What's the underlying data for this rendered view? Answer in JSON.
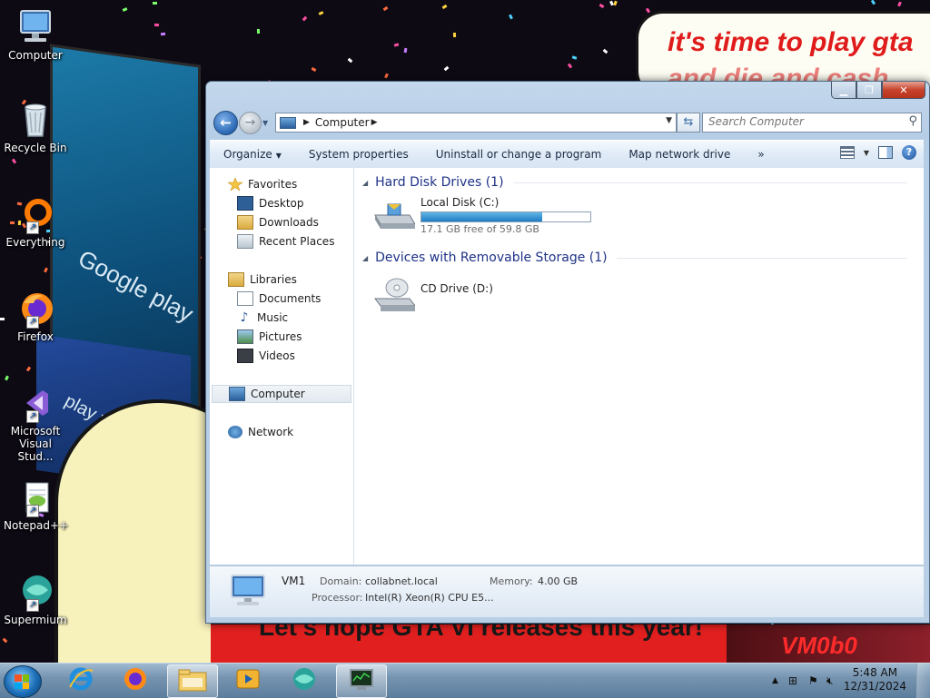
{
  "desktop": {
    "wallpaper_text_top": "it's time to play gta",
    "wallpaper_text_top2": "and die and cash",
    "wallpaper_text_bottom": "Let's hope GTA VI releases this year!",
    "wallpaper_text_right": "VM0b0",
    "billboard_text": "Google play",
    "billboard_text2": "play your he",
    "icons": [
      {
        "label": "Computer",
        "icon": "computer-icon"
      },
      {
        "label": "Recycle Bin",
        "icon": "recycle-bin-icon"
      },
      {
        "label": "Everything",
        "icon": "everything-icon"
      },
      {
        "label": "Firefox",
        "icon": "firefox-icon"
      },
      {
        "label": "Microsoft Visual Stud...",
        "icon": "visual-studio-icon"
      },
      {
        "label": "Notepad++",
        "icon": "notepad-plus-plus-icon"
      },
      {
        "label": "Supermium",
        "icon": "supermium-icon"
      }
    ]
  },
  "window": {
    "caption_buttons": {
      "minimize": "▁",
      "maximize": "❐",
      "close": "✕"
    },
    "address": {
      "location": "Computer"
    },
    "search": {
      "placeholder": "Search Computer"
    },
    "toolbar": {
      "organize": "Organize",
      "system_properties": "System properties",
      "uninstall": "Uninstall or change a program",
      "map_drive": "Map network drive",
      "more": "»"
    },
    "nav": {
      "favorites": "Favorites",
      "desktop": "Desktop",
      "downloads": "Downloads",
      "recent_places": "Recent Places",
      "libraries": "Libraries",
      "documents": "Documents",
      "music": "Music",
      "pictures": "Pictures",
      "videos": "Videos",
      "computer": "Computer",
      "network": "Network"
    },
    "groups": {
      "hdd_header": "Hard Disk Drives (1)",
      "removable_header": "Devices with Removable Storage (1)"
    },
    "drives": {
      "local_disk": {
        "name": "Local Disk (C:)",
        "free_text": "17.1 GB free of 59.8 GB",
        "used_fraction": 0.714
      },
      "cd_drive": {
        "name": "CD Drive (D:)"
      }
    },
    "details": {
      "name": "VM1",
      "domain_label": "Domain:",
      "domain_value": "collabnet.local",
      "memory_label": "Memory:",
      "memory_value": "4.00 GB",
      "processor_label": "Processor:",
      "processor_value": "Intel(R) Xeon(R) CPU E5..."
    }
  },
  "taskbar": {
    "time": "5:48 AM",
    "date": "12/31/2024",
    "pinned": [
      "internet-explorer-icon",
      "firefox-icon",
      "windows-explorer-icon",
      "media-player-icon",
      "supermium-icon",
      "task-manager-icon"
    ]
  },
  "colors": {
    "group_header": "#1e3287",
    "drive_bar": "#1f7cc4",
    "close_button": "#c7432c",
    "taskbar": "#7694b0"
  }
}
